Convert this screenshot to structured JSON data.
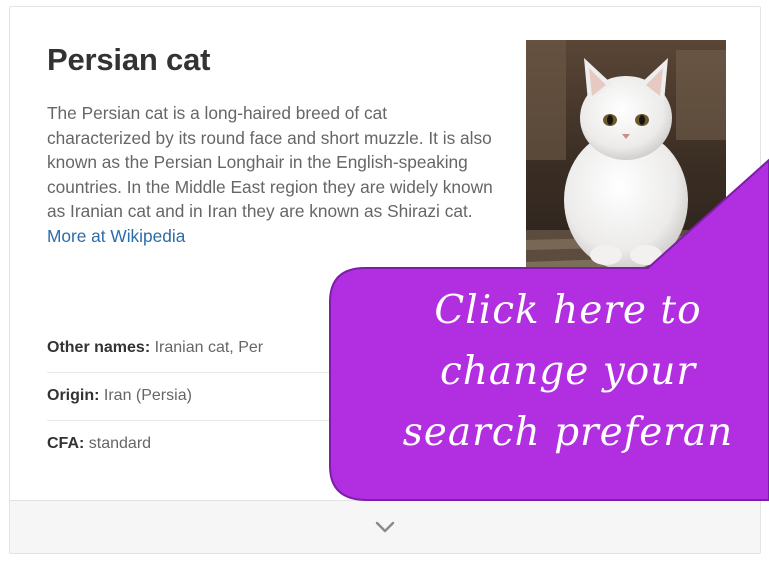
{
  "panel": {
    "title": "Persian cat",
    "description": "The Persian cat is a long-haired breed of cat characterized by its round face and short muzzle. It is also known as the Persian Longhair in the English-speaking countries. In the Middle East region they are widely known as Iranian cat and in Iran they are known as Shirazi cat.",
    "more_link": "More at Wikipedia",
    "facts": [
      {
        "label": "Other names:",
        "value": "Iranian cat, Per"
      },
      {
        "label": "Origin:",
        "value": "Iran (Persia)"
      },
      {
        "label": "CFA:",
        "value": "standard"
      }
    ],
    "expand_icon": "chevron-down-icon"
  },
  "callout": {
    "lines": [
      "Click here to",
      "change your",
      "search preferan"
    ],
    "color": "#b12fe0",
    "border_color": "#7d1fa6"
  }
}
